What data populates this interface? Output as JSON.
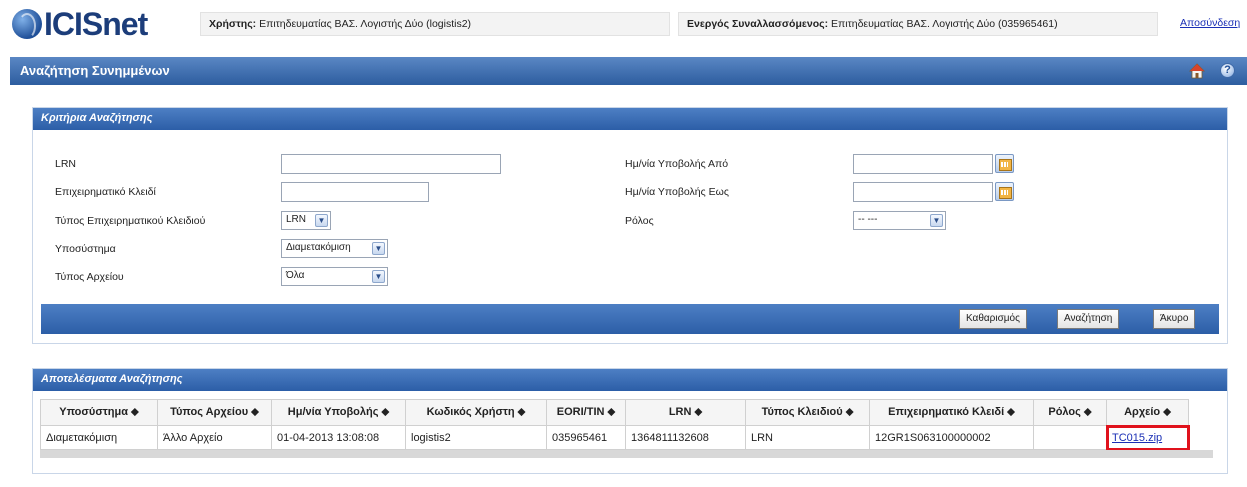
{
  "header": {
    "logo_text": "ICISnet",
    "user_label": "Χρήστης:",
    "user_value": "Επιτηδευματίας ΒΑΣ. Λογιστής Δύο (logistis2)",
    "party_label": "Ενεργός Συναλλασσόμενος:",
    "party_value": "Επιτηδευματίας ΒΑΣ. Λογιστής Δύο (035965461)",
    "logout": "Αποσύνδεση"
  },
  "titlebar": {
    "title": "Αναζήτηση Συνημμένων",
    "help": "?"
  },
  "criteria": {
    "title": "Κριτήρια Αναζήτησης",
    "lrn_label": "LRN",
    "lrn_value": "",
    "key_label": "Επιχειρηματικό Κλειδί",
    "key_value": "",
    "key_type_label": "Τύπος Επιχειρηματικού Κλειδιού",
    "key_type_value": "LRN",
    "subsystem_label": "Υποσύστημα",
    "subsystem_value": "Διαμετακόμιση",
    "file_type_label": "Τύπος Αρχείου",
    "file_type_value": "Όλα",
    "date_from_label": "Ημ/νία Υποβολής Από",
    "date_from_value": "",
    "date_to_label": "Ημ/νία Υποβολής Εως",
    "date_to_value": "",
    "role_label": "Ρόλος",
    "role_value": "-- ---",
    "btn_clear": "Καθαρισμός",
    "btn_search": "Αναζήτηση",
    "btn_cancel": "Άκυρο"
  },
  "results": {
    "title": "Αποτελέσματα Αναζήτησης",
    "columns": [
      "Υποσύστημα ⬥",
      "Τύπος Αρχείου ⬥",
      "Ημ/νία Υποβολής ⬥",
      "Κωδικός Χρήστη ⬥",
      "EORI/TIN ⬥",
      "LRN ⬥",
      "Τύπος Κλειδιού ⬥",
      "Επιχειρηματικό Κλειδί ⬥",
      "Ρόλος ⬥",
      "Αρχείο ⬥"
    ],
    "rows": [
      [
        "Διαμετακόμιση",
        "Άλλο Αρχείο",
        "01-04-2013 13:08:08",
        "logistis2",
        "035965461",
        "1364811132608",
        "LRN",
        "12GR1S063100000002",
        "",
        "TC015.zip"
      ]
    ]
  },
  "colors": {
    "titlebar": "#2d5d9f",
    "panel_header": "#2c5ea7",
    "link": "#1a2fb5",
    "highlight": "#e0121c"
  }
}
